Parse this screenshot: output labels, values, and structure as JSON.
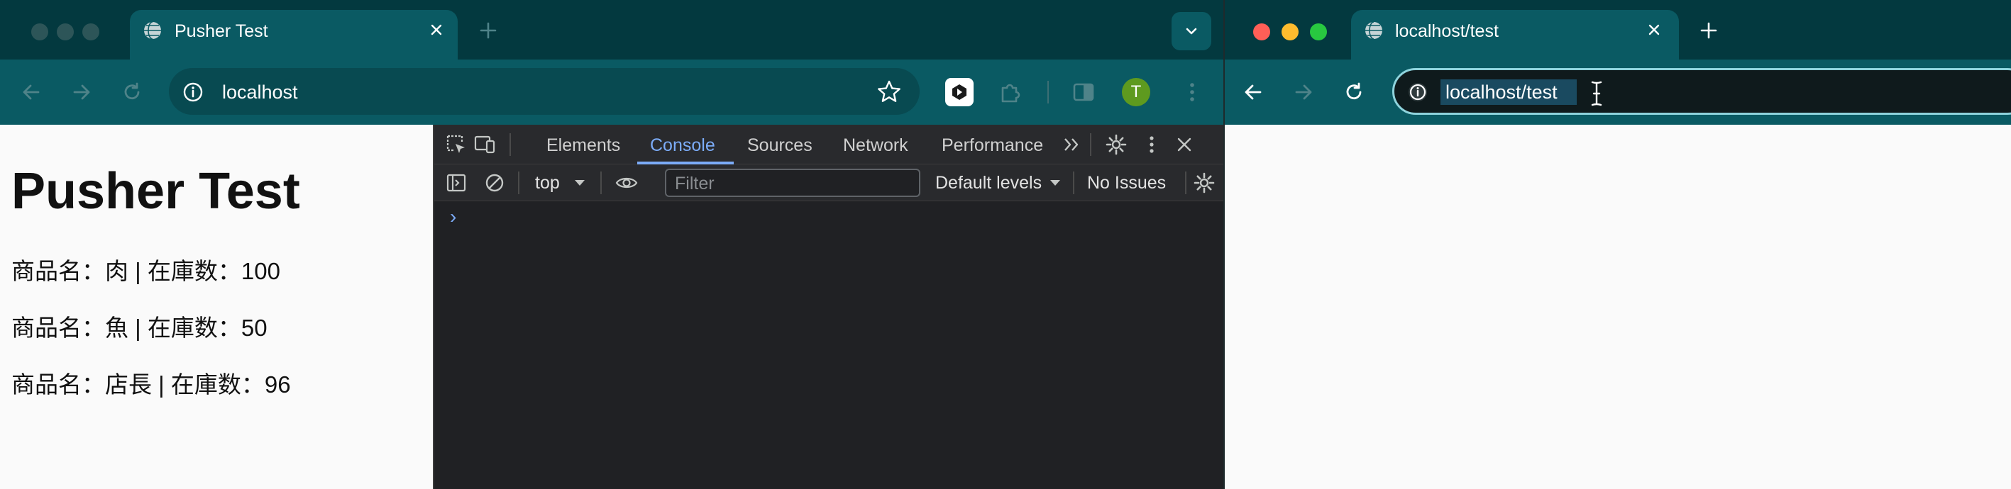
{
  "left_window": {
    "tab_title": "Pusher Test",
    "url": "localhost",
    "profile_initial": "T",
    "page": {
      "heading": "Pusher Test",
      "items": [
        "商品名：肉 | 在庫数：100",
        "商品名：魚 | 在庫数：50",
        "商品名：店長 | 在庫数：96"
      ]
    },
    "devtools": {
      "tabs": [
        "Elements",
        "Console",
        "Sources",
        "Network",
        "Performance"
      ],
      "context": "top",
      "filter_placeholder": "Filter",
      "levels": "Default levels",
      "issues": "No Issues",
      "prompt": "›"
    }
  },
  "right_window": {
    "tab_title": "localhost/test",
    "url": "localhost/test"
  },
  "colors": {
    "tabstrip": "#03393f",
    "toolbar": "#0a5a63",
    "devtools_bg": "#202124",
    "devtools_accent": "#7cacf8",
    "profile_green": "#5e9a1f",
    "url_selection": "#1a4a60",
    "focus_ring": "#8ed3dc"
  }
}
